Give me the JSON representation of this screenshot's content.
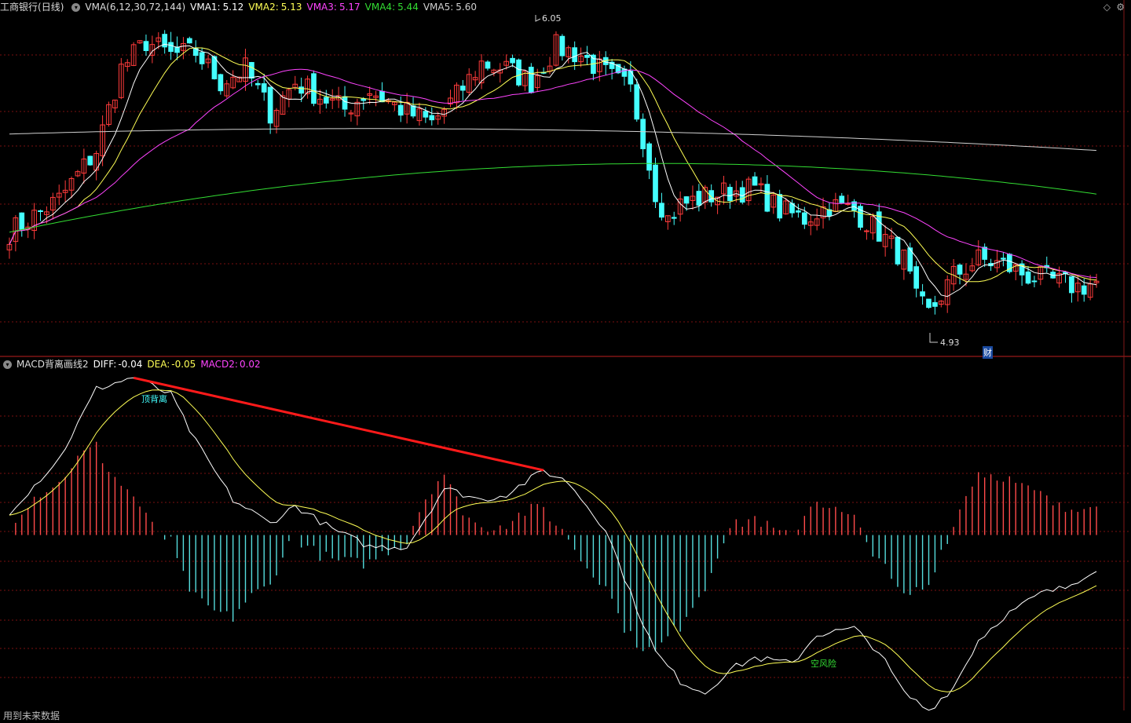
{
  "header": {
    "stock_name": "工商银行",
    "period": "(日线)",
    "indicator_name": "VMA(6,12,30,72,144)",
    "vma": [
      {
        "label": "VMA1:",
        "value": "5.12",
        "color": "#ffffff"
      },
      {
        "label": "VMA2:",
        "value": "5.13",
        "color": "#ffff55"
      },
      {
        "label": "VMA3:",
        "value": "5.17",
        "color": "#ff44ff"
      },
      {
        "label": "VMA4:",
        "value": "5.44",
        "color": "#33dd33"
      },
      {
        "label": "VMA5:",
        "value": "5.60",
        "color": "#d0d0d0"
      }
    ]
  },
  "macd_header": {
    "indicator_name": "MACD背离画线2",
    "diff": {
      "label": "DIFF:",
      "value": "-0.04",
      "color": "#ffffff"
    },
    "dea": {
      "label": "DEA:",
      "value": "-0.05",
      "color": "#ffff55"
    },
    "macd2": {
      "label": "MACD2:",
      "value": "0.02",
      "color": "#ff44ff"
    }
  },
  "annotations": {
    "high_price": "6.05",
    "low_price": "4.93",
    "top_divergence": "顶背离",
    "risk": "空风险",
    "finance_tag": "财"
  },
  "footer": "用到未来数据",
  "icons": {
    "collapse": "chevron-down-icon",
    "diamond": "diamond-icon",
    "settings": "gear-icon"
  },
  "colors": {
    "up": "#ff3b3b",
    "down": "#44ffff",
    "grid": "#7a1010",
    "bar_up": "#ff4a4a",
    "bar_down": "#55dddd",
    "divergence_line": "#ff1a1a"
  },
  "chart_data": [
    {
      "type": "candlestick",
      "title": "工商银行 (日线)",
      "ylim": [
        4.85,
        6.1
      ],
      "high_price": 6.05,
      "low_price": 4.93,
      "ohlc_anchors": [
        [
          0,
          5.3
        ],
        [
          8,
          5.42
        ],
        [
          14,
          5.6
        ],
        [
          18,
          5.9
        ],
        [
          22,
          6.0
        ],
        [
          26,
          5.95
        ],
        [
          30,
          5.96
        ],
        [
          34,
          5.85
        ],
        [
          38,
          5.9
        ],
        [
          42,
          5.74
        ],
        [
          46,
          5.85
        ],
        [
          50,
          5.8
        ],
        [
          54,
          5.75
        ],
        [
          58,
          5.82
        ],
        [
          64,
          5.74
        ],
        [
          68,
          5.7
        ],
        [
          72,
          5.8
        ],
        [
          76,
          5.92
        ],
        [
          80,
          5.9
        ],
        [
          84,
          5.85
        ],
        [
          88,
          5.98
        ],
        [
          92,
          5.95
        ],
        [
          96,
          5.88
        ],
        [
          100,
          5.82
        ],
        [
          102,
          5.65
        ],
        [
          104,
          5.45
        ],
        [
          106,
          5.35
        ],
        [
          108,
          5.4
        ],
        [
          112,
          5.43
        ],
        [
          116,
          5.45
        ],
        [
          120,
          5.46
        ],
        [
          124,
          5.38
        ],
        [
          128,
          5.35
        ],
        [
          132,
          5.4
        ],
        [
          136,
          5.38
        ],
        [
          140,
          5.3
        ],
        [
          144,
          5.2
        ],
        [
          146,
          5.05
        ],
        [
          148,
          5.0
        ],
        [
          152,
          5.14
        ],
        [
          156,
          5.2
        ],
        [
          160,
          5.18
        ],
        [
          164,
          5.14
        ],
        [
          168,
          5.12
        ],
        [
          172,
          5.1
        ],
        [
          176,
          5.12
        ]
      ],
      "n_candles": 176,
      "series": [
        {
          "name": "VMA1",
          "period": 6,
          "color": "#ffffff"
        },
        {
          "name": "VMA2",
          "period": 12,
          "color": "#ffff55"
        },
        {
          "name": "VMA3",
          "period": 30,
          "color": "#ff44ff"
        },
        {
          "name": "VMA4",
          "period": 72,
          "color": "#33dd33",
          "start": 5.3,
          "mid": 5.72,
          "end": 5.44
        },
        {
          "name": "VMA5",
          "period": 144,
          "color": "#d0d0d0",
          "start": 5.66,
          "mid": 5.72,
          "end": 5.6
        }
      ]
    },
    {
      "type": "line",
      "title": "MACD背离画线2",
      "ylim": [
        -0.3,
        0.28
      ],
      "diff_anchors": [
        [
          0,
          0.04
        ],
        [
          8,
          0.13
        ],
        [
          14,
          0.25
        ],
        [
          20,
          0.27
        ],
        [
          26,
          0.24
        ],
        [
          30,
          0.16
        ],
        [
          36,
          0.06
        ],
        [
          42,
          0.02
        ],
        [
          46,
          0.05
        ],
        [
          52,
          0.01
        ],
        [
          58,
          -0.02
        ],
        [
          64,
          -0.02
        ],
        [
          70,
          0.08
        ],
        [
          76,
          0.06
        ],
        [
          80,
          0.07
        ],
        [
          86,
          0.11
        ],
        [
          90,
          0.09
        ],
        [
          96,
          0.01
        ],
        [
          100,
          -0.1
        ],
        [
          104,
          -0.2
        ],
        [
          108,
          -0.25
        ],
        [
          112,
          -0.27
        ],
        [
          116,
          -0.23
        ],
        [
          120,
          -0.21
        ],
        [
          126,
          -0.22
        ],
        [
          130,
          -0.17
        ],
        [
          136,
          -0.16
        ],
        [
          140,
          -0.2
        ],
        [
          144,
          -0.27
        ],
        [
          148,
          -0.3
        ],
        [
          152,
          -0.26
        ],
        [
          156,
          -0.18
        ],
        [
          160,
          -0.14
        ],
        [
          166,
          -0.1
        ],
        [
          170,
          -0.09
        ],
        [
          176,
          -0.05
        ]
      ],
      "series": [
        {
          "name": "DIFF",
          "color": "#ffffff"
        },
        {
          "name": "DEA",
          "color": "#ffff55"
        },
        {
          "name": "MACD2",
          "color": "#ff44ff"
        }
      ]
    }
  ]
}
